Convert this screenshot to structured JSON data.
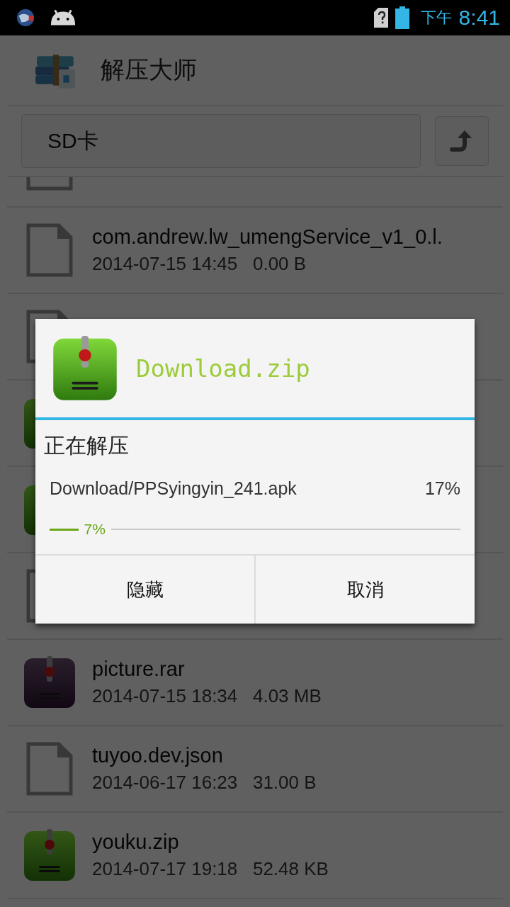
{
  "status_bar": {
    "period": "下午",
    "time": "8:41"
  },
  "app_bar": {
    "title": "解压大师"
  },
  "path_bar": {
    "path": "SD卡"
  },
  "files": [
    {
      "kind": "file"
    },
    {
      "kind": "file",
      "name": "com.andrew.lw_umengService_v1_0.l.",
      "details": "2014-07-15 14:45   0.00 B"
    },
    {
      "kind": "file"
    },
    {
      "kind": "zip"
    },
    {
      "kind": "zip"
    },
    {
      "kind": "file"
    },
    {
      "kind": "rar",
      "name": "picture.rar",
      "details": "2014-07-15 18:34   4.03 MB"
    },
    {
      "kind": "file",
      "name": "tuyoo.dev.json",
      "details": "2014-06-17 16:23   31.00 B"
    },
    {
      "kind": "zip",
      "name": "youku.zip",
      "details": "2014-07-17 19:18   52.48 KB"
    }
  ],
  "dialog": {
    "title": "Download.zip",
    "message": "正在解压",
    "current_file": "Download/PPSyingyin_241.apk",
    "file_percent": "17%",
    "progress": {
      "level": 0.07,
      "label": "7%"
    },
    "buttons": [
      "隐藏",
      "取消"
    ]
  }
}
